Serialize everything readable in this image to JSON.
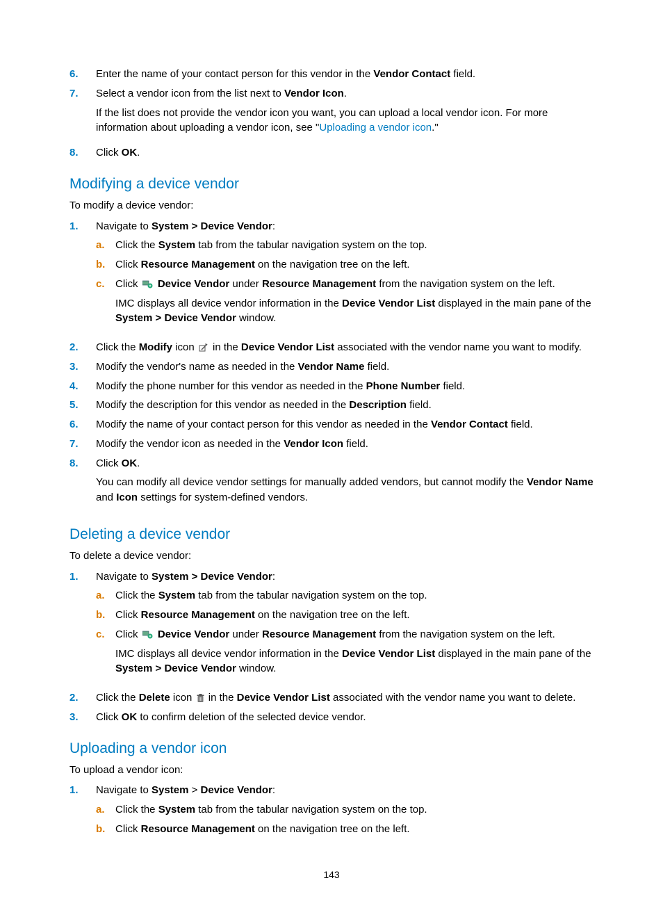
{
  "page_number": "143",
  "intro": {
    "step6_a": "Enter the name of your contact person for this vendor in the ",
    "step6_b": "Vendor Contact",
    "step6_c": " field.",
    "step7_a": "Select a vendor icon from the list next to ",
    "step7_b": "Vendor Icon",
    "step7_c": ".",
    "step7_note_a": "If the list does not provide the vendor icon you want, you can upload a local vendor icon. For more information about uploading a vendor icon, see \"",
    "step7_link": "Uploading a vendor icon",
    "step7_note_b": ".\"",
    "step8_a": "Click ",
    "step8_b": "OK",
    "step8_c": "."
  },
  "mod": {
    "heading": "Modifying a device vendor",
    "lead": "To modify a device vendor:",
    "s1_a": "Navigate to ",
    "s1_b": "System > Device Vendor",
    "s1_c": ":",
    "s1a_a": "Click the ",
    "s1a_b": "System",
    "s1a_c": " tab from the tabular navigation system on the top.",
    "s1b_a": "Click ",
    "s1b_b": "Resource Management",
    "s1b_c": " on the navigation tree on the left.",
    "s1c_a": "Click ",
    "s1c_b": "Device Vendor",
    "s1c_c": " under ",
    "s1c_d": "Resource Management",
    "s1c_e": " from the navigation system on the left.",
    "s1c_note_a": "IMC displays all device vendor information in the ",
    "s1c_note_b": "Device Vendor List",
    "s1c_note_c": " displayed in the main pane of the ",
    "s1c_note_d": "System > Device Vendor",
    "s1c_note_e": " window.",
    "s2_a": "Click the ",
    "s2_b": "Modify",
    "s2_c": " icon ",
    "s2_d": " in the ",
    "s2_e": "Device Vendor List",
    "s2_f": " associated with the vendor name you want to modify.",
    "s3_a": "Modify the vendor's name as needed in the ",
    "s3_b": "Vendor Name",
    "s3_c": " field.",
    "s4_a": "Modify the phone number for this vendor as needed in the ",
    "s4_b": "Phone Number",
    "s4_c": " field.",
    "s5_a": "Modify the description for this vendor as needed in the ",
    "s5_b": "Description",
    "s5_c": " field.",
    "s6_a": "Modify the name of your contact person for this vendor as needed in the ",
    "s6_b": "Vendor Contact",
    "s6_c": " field.",
    "s7_a": "Modify the vendor icon as needed in the ",
    "s7_b": "Vendor Icon",
    "s7_c": " field.",
    "s8_a": "Click ",
    "s8_b": "OK",
    "s8_c": ".",
    "s8_note_a": "You can modify all device vendor settings for manually added vendors, but cannot modify the ",
    "s8_note_b": "Vendor Name",
    "s8_note_c": " and ",
    "s8_note_d": "Icon",
    "s8_note_e": " settings for system-defined vendors."
  },
  "del": {
    "heading": "Deleting a device vendor",
    "lead": "To delete a device vendor:",
    "s1_a": "Navigate to ",
    "s1_b": "System > Device Vendor",
    "s1_c": ":",
    "s1a_a": "Click the ",
    "s1a_b": "System",
    "s1a_c": " tab from the tabular navigation system on the top.",
    "s1b_a": "Click ",
    "s1b_b": "Resource Management",
    "s1b_c": " on the navigation tree on the left.",
    "s1c_a": "Click ",
    "s1c_b": "Device Vendor",
    "s1c_c": " under ",
    "s1c_d": "Resource Management",
    "s1c_e": " from the navigation system on the left.",
    "s1c_note_a": "IMC displays all device vendor information in the ",
    "s1c_note_b": "Device Vendor List",
    "s1c_note_c": " displayed in the main pane of the ",
    "s1c_note_d": "System > Device Vendor",
    "s1c_note_e": " window.",
    "s2_a": "Click the ",
    "s2_b": "Delete",
    "s2_c": " icon ",
    "s2_d": " in the ",
    "s2_e": "Device Vendor List",
    "s2_f": " associated with the vendor name you want to delete.",
    "s3_a": "Click ",
    "s3_b": "OK",
    "s3_c": " to confirm deletion of the selected device vendor."
  },
  "upl": {
    "heading": "Uploading a vendor icon",
    "lead": "To upload a vendor icon:",
    "s1_a": "Navigate to ",
    "s1_b": "System",
    "s1_c": " > ",
    "s1_d": "Device Vendor",
    "s1_e": ":",
    "s1a_a": "Click the ",
    "s1a_b": "System",
    "s1a_c": " tab from the tabular navigation system on the top.",
    "s1b_a": "Click ",
    "s1b_b": "Resource Management",
    "s1b_c": " on the navigation tree on the left."
  },
  "markers": {
    "n1": "1.",
    "n2": "2.",
    "n3": "3.",
    "n4": "4.",
    "n5": "5.",
    "n6": "6.",
    "n7": "7.",
    "n8": "8.",
    "a": "a.",
    "b": "b.",
    "c": "c."
  }
}
